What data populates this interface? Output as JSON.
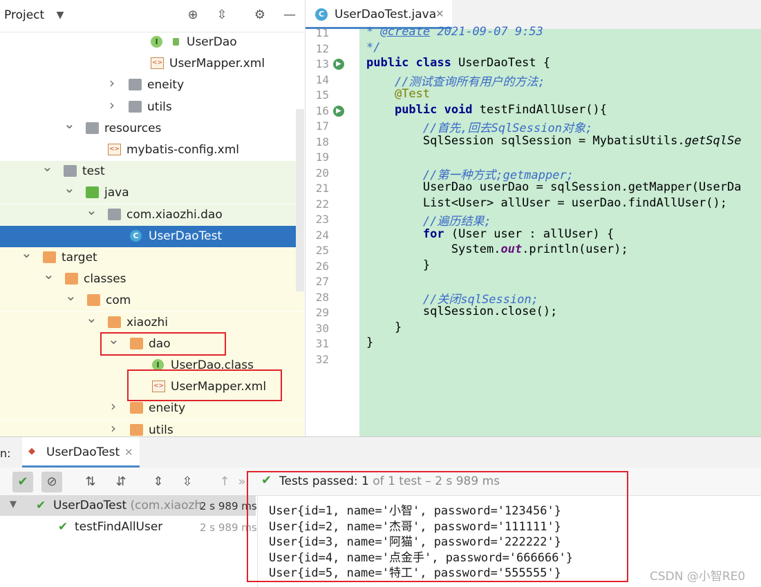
{
  "project": {
    "title": "Project",
    "tree": [
      {
        "label": "UserDao",
        "kind": "interface",
        "indent": 218,
        "lock": true
      },
      {
        "label": "UserMapper.xml",
        "kind": "xml",
        "indent": 218
      },
      {
        "label": "eneity",
        "kind": "folder-gray",
        "indent": 186,
        "chev": ">"
      },
      {
        "label": "utils",
        "kind": "folder-gray",
        "indent": 186,
        "chev": ">"
      },
      {
        "label": "resources",
        "kind": "folder-gray",
        "indent": 124,
        "chev": "v"
      },
      {
        "label": "mybatis-config.xml",
        "kind": "xml",
        "indent": 156
      },
      {
        "label": "test",
        "kind": "folder-gray",
        "indent": 92,
        "chev": "v"
      },
      {
        "label": "java",
        "kind": "folder-green",
        "indent": 124,
        "chev": "v"
      },
      {
        "label": "com.xiaozhi.dao",
        "kind": "folder-gray",
        "indent": 156,
        "chev": "v"
      },
      {
        "label": "UserDaoTest",
        "kind": "class",
        "indent": 188,
        "selected": true
      },
      {
        "label": "target",
        "kind": "folder-orange",
        "indent": 62,
        "chev": "v"
      },
      {
        "label": "classes",
        "kind": "folder-orange",
        "indent": 94,
        "chev": "v"
      },
      {
        "label": "com",
        "kind": "folder-orange",
        "indent": 126,
        "chev": "v"
      },
      {
        "label": "xiaozhi",
        "kind": "folder-orange",
        "indent": 156,
        "chev": "v"
      },
      {
        "label": "dao",
        "kind": "folder-orange",
        "indent": 188,
        "chev": "v"
      },
      {
        "label": "UserDao.class",
        "kind": "interface",
        "indent": 220
      },
      {
        "label": "UserMapper.xml",
        "kind": "xml",
        "indent": 220
      },
      {
        "label": "eneity",
        "kind": "folder-orange",
        "indent": 188,
        "chev": ">"
      },
      {
        "label": "utils",
        "kind": "folder-orange",
        "indent": 188,
        "chev": ">"
      }
    ]
  },
  "editor": {
    "tab": "UserDaoTest.java",
    "lines": [
      {
        "n": "11",
        "html": "<span class=\"doc\">* <u>@create</u> 2021-09-07 9:53</span>"
      },
      {
        "n": "12",
        "html": "<span class=\"doc\">*/</span>"
      },
      {
        "n": "13",
        "html": "<span class=\"kw\">public class</span> UserDaoTest {",
        "run": true
      },
      {
        "n": "14",
        "html": "    <span class=\"cm\">//测试查询所有用户的方法;</span>"
      },
      {
        "n": "15",
        "html": "    <span class=\"ann\">@Test</span>"
      },
      {
        "n": "16",
        "html": "    <span class=\"kw\">public void</span> testFindAllUser(){",
        "run": true
      },
      {
        "n": "17",
        "html": "        <span class=\"cm\">//首先,回去SqlSession对象;</span>"
      },
      {
        "n": "18",
        "html": "        SqlSession sqlSession = MybatisUtils.<i>getSqlSe</i>"
      },
      {
        "n": "19",
        "html": ""
      },
      {
        "n": "20",
        "html": "        <span class=\"cm\">//第一种方式;getmapper;</span>"
      },
      {
        "n": "21",
        "html": "        UserDao userDao = sqlSession.getMapper(UserDa"
      },
      {
        "n": "22",
        "html": "        List&lt;User&gt; allUser = userDao.findAllUser();"
      },
      {
        "n": "23",
        "html": "        <span class=\"cm\">//遍历结果;</span>"
      },
      {
        "n": "24",
        "html": "        <span class=\"kw\">for</span> (User user : allUser) {"
      },
      {
        "n": "25",
        "html": "            System.<span class=\"fld\">out</span>.println(user);"
      },
      {
        "n": "26",
        "html": "        }"
      },
      {
        "n": "27",
        "html": ""
      },
      {
        "n": "28",
        "html": "        <span class=\"cm\">//关闭sqlSession;</span>"
      },
      {
        "n": "29",
        "html": "        sqlSession.close();"
      },
      {
        "n": "30",
        "html": "    }"
      },
      {
        "n": "31",
        "html": "}"
      },
      {
        "n": "32",
        "html": ""
      }
    ]
  },
  "run": {
    "prefix": "n:",
    "tab_label": "UserDaoTest",
    "status_label": "Tests passed:",
    "status_count": "1",
    "status_rest": "of 1 test – 2 s 989 ms",
    "tree": [
      {
        "name": "UserDaoTest",
        "suffix": "(com.xiaozh",
        "duration": "2 s 989 ms"
      },
      {
        "name": "testFindAllUser",
        "duration": "2 s 989 ms"
      }
    ],
    "output": [
      "User{id=1, name='小智', password='123456'}",
      "User{id=2, name='杰哥', password='111111'}",
      "User{id=3, name='阿猫', password='222222'}",
      "User{id=4, name='点金手', password='666666'}",
      "User{id=5, name='特工', password='555555'}"
    ]
  },
  "watermark": "CSDN @小智RE0"
}
